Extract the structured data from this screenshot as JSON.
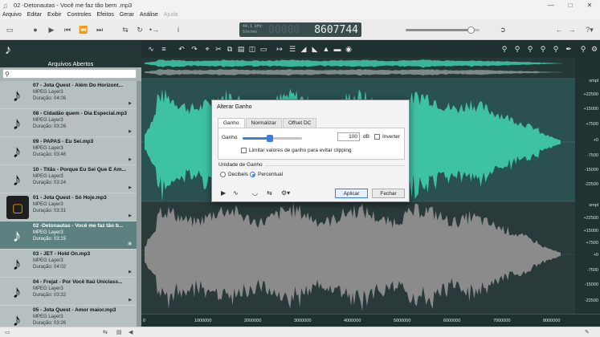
{
  "window": {
    "title": "02 -Detonautas - Você me faz tão bem .mp3"
  },
  "menu": [
    "Arquivo",
    "Editar",
    "Exibir",
    "Controles",
    "Efeitos",
    "Gerar",
    "Análise",
    "Ajuda"
  ],
  "lcd": {
    "rate": "44,1 kHz",
    "mode": "Stereo",
    "ghost": "00000",
    "position": "8607744"
  },
  "volume_level": 0.88,
  "sidebar": {
    "title": "Arquivos Abertos",
    "files": [
      {
        "name": "07 - Jota Quest - Além Do Horizont...",
        "format": "MPEG Layer3",
        "duration": "Duração: 04:06"
      },
      {
        "name": "08 - Cidadão quem - Dia Especial.mp3",
        "format": "MPEG Layer3",
        "duration": "Duração: 03:26"
      },
      {
        "name": "09 - PAPAS - Eu Sei.mp3",
        "format": "MPEG Layer3",
        "duration": "Duração: 03:46"
      },
      {
        "name": "10 - Titãs - Porque Eu Sei Que É Am...",
        "format": "MPEG Layer3",
        "duration": "Duração: 03:24"
      },
      {
        "name": "01 - Jota Quest - Só Hoje.mp3",
        "format": "MPEG Layer3",
        "duration": "Duração: 03:31"
      },
      {
        "name": "02 -Detonautas - Você me faz tão b...",
        "format": "MPEG Layer3",
        "duration": "Duração: 03:15"
      },
      {
        "name": "03 - JET - Hold On.mp3",
        "format": "MPEG Layer3",
        "duration": "Duração: 04:02"
      },
      {
        "name": "04 - Frejat - Por Você Itaú Uniclass...",
        "format": "MPEG Layer3",
        "duration": "Duração: 03:32"
      },
      {
        "name": "05 - Jota Quest - Amor maior.mp3",
        "format": "MPEG Layer3",
        "duration": "Duração: 03:26"
      }
    ]
  },
  "ruler": {
    "unit": "smpl",
    "top": [
      "+22500",
      "+15000",
      "+7500",
      "+0",
      "-7500",
      "-15000",
      "-22500"
    ],
    "bottom": [
      "smpl",
      "+22500",
      "+15000",
      "+7500",
      "+0",
      "-7500",
      "-15000",
      "-22500"
    ]
  },
  "timeaxis": [
    "0",
    "1000000",
    "2000000",
    "3000000",
    "4000000",
    "5000000",
    "6000000",
    "7000000",
    "8000000"
  ],
  "dialog": {
    "title": "Alterar Ganho",
    "tabs": [
      "Ganho",
      "Normalizar",
      "Offset DC"
    ],
    "gain_label": "Ganho",
    "gain_value": "100",
    "gain_unit": "dB",
    "gain_level": 0.46,
    "invert_label": "Inverter",
    "limit_label": "Limitar valores de ganho para evitar clipping",
    "unit_section": "Unidade de Ganho",
    "unit_decibels": "Decibels",
    "unit_percent": "Percentual",
    "apply": "Aplicar",
    "close": "Fechar"
  },
  "colors": {
    "waveform": "#3ec3a2",
    "waveform_dim": "#8b8b8b",
    "selection": "#5d8181"
  }
}
